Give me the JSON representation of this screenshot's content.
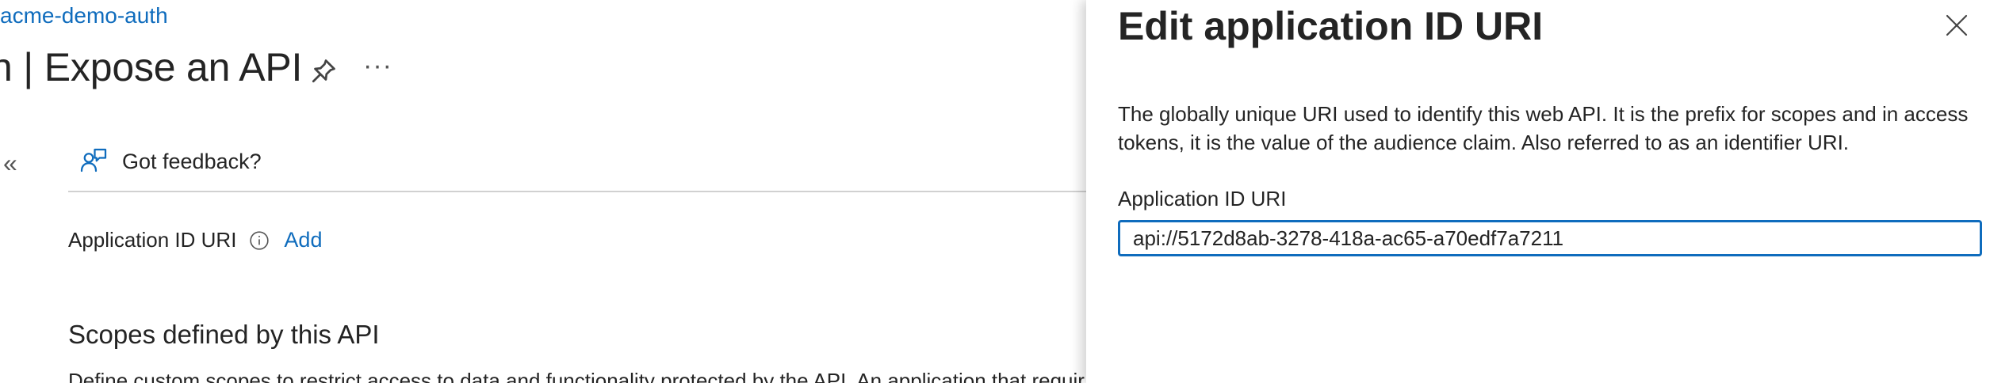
{
  "breadcrumb": {
    "app_name": "acme-demo-auth"
  },
  "page": {
    "title": "n | Expose an API",
    "more_label": "···"
  },
  "toolbar": {
    "collapse_label": "«",
    "feedback_label": "Got feedback?"
  },
  "app_id_row": {
    "label": "Application ID URI",
    "add_label": "Add"
  },
  "scopes": {
    "heading": "Scopes defined by this API",
    "description": "Define custom scopes to restrict access to data and functionality protected by the API. An application that requir"
  },
  "panel": {
    "title": "Edit application ID URI",
    "description": "The globally unique URI used to identify this web API. It is the prefix for scopes and in access tokens, it is the value of the audience claim. Also referred to as an identifier URI.",
    "field_label": "Application ID URI",
    "field_value": "api://5172d8ab-3278-418a-ac65-a70edf7a7211"
  },
  "colors": {
    "link": "#0f6cbd",
    "text": "#242424",
    "divider": "#d1d1d1",
    "focus_border": "#0f6cbd"
  },
  "icons": [
    "pin-icon",
    "more-icon",
    "collapse-icon",
    "feedback-icon",
    "info-icon",
    "close-icon"
  ]
}
